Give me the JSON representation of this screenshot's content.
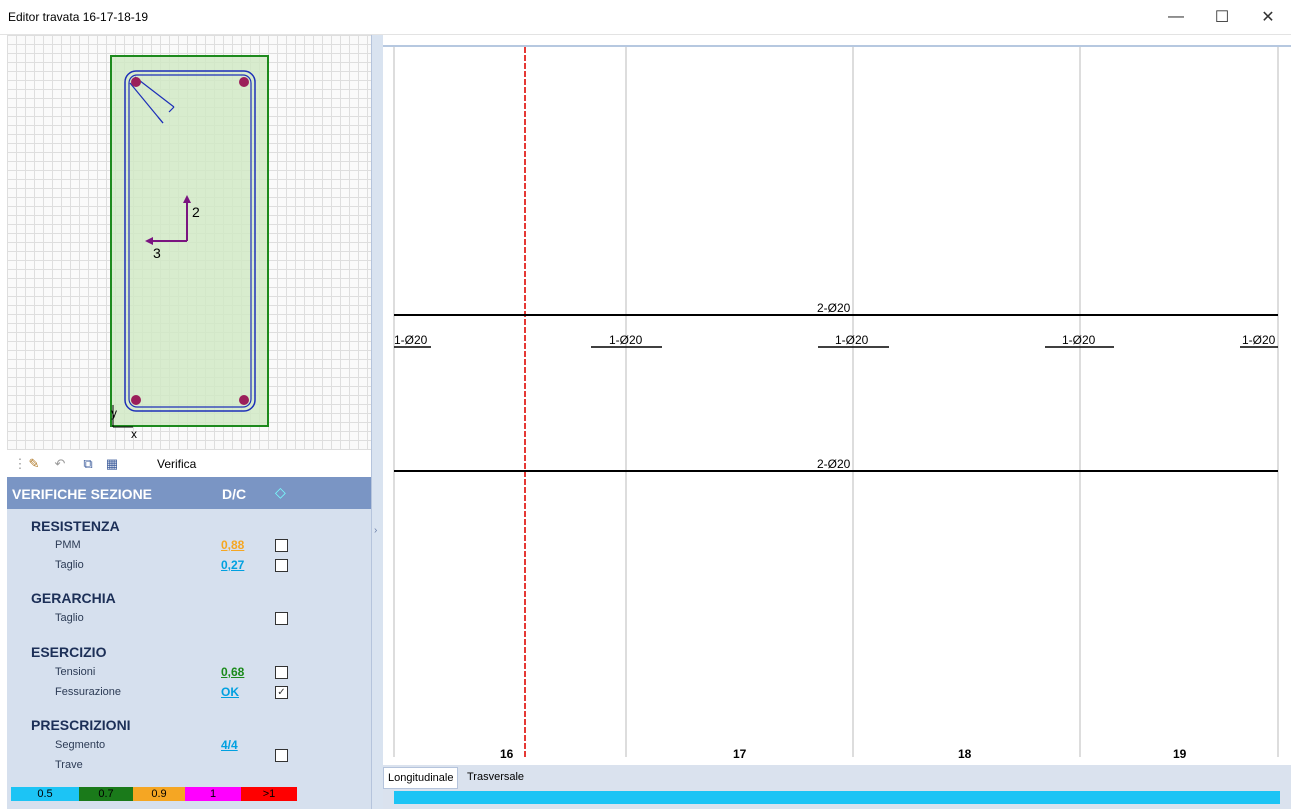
{
  "window": {
    "title": "Editor travata 16-17-18-19"
  },
  "section_view": {
    "axis_local_2": "2",
    "axis_local_3": "3",
    "axis_x": "x",
    "axis_y": "y"
  },
  "toolbar": {
    "verifica_label": "Verifica"
  },
  "checks": {
    "header_title": "VERIFICHE SEZIONE",
    "header_dc": "D/C",
    "resistenza": {
      "title": "RESISTENZA",
      "pmm_label": "PMM",
      "pmm_value": "0,88",
      "pmm_color": "#f5a623",
      "pmm_checked": false,
      "taglio_label": "Taglio",
      "taglio_value": "0,27",
      "taglio_color": "#00a0e0",
      "taglio_checked": false
    },
    "gerarchia": {
      "title": "GERARCHIA",
      "taglio_label": "Taglio",
      "taglio_checked": false
    },
    "esercizio": {
      "title": "ESERCIZIO",
      "tensioni_label": "Tensioni",
      "tensioni_value": "0,68",
      "tensioni_color": "#1a8a1a",
      "tensioni_checked": false,
      "fessurazione_label": "Fessurazione",
      "fessurazione_value": "OK",
      "fessurazione_color": "#00a0e0",
      "fessurazione_checked": true
    },
    "prescrizioni": {
      "title": "PRESCRIZIONI",
      "segmento_label": "Segmento",
      "segmento_value": "4/4",
      "segmento_color": "#00a0e0",
      "trave_label": "Trave",
      "checked": false
    },
    "legend": [
      {
        "label": "0.5",
        "color": "#1cc4f5"
      },
      {
        "label": "0.7",
        "color": "#1a7a1a"
      },
      {
        "label": "0.9",
        "color": "#f5a623"
      },
      {
        "label": "1",
        "color": "#ff00ff"
      },
      {
        "label": ">1",
        "color": "#ff0000"
      }
    ]
  },
  "longitudinal": {
    "top_bar_label": "2-Ø20",
    "bottom_bar_label": "2-Ø20",
    "extra_bar_labels": [
      "1-Ø20",
      "1-Ø20",
      "1-Ø20",
      "1-Ø20",
      "1-Ø20"
    ],
    "spans": [
      "16",
      "17",
      "18",
      "19"
    ]
  },
  "tabs": [
    "Longitudinale",
    "Trasversale"
  ]
}
